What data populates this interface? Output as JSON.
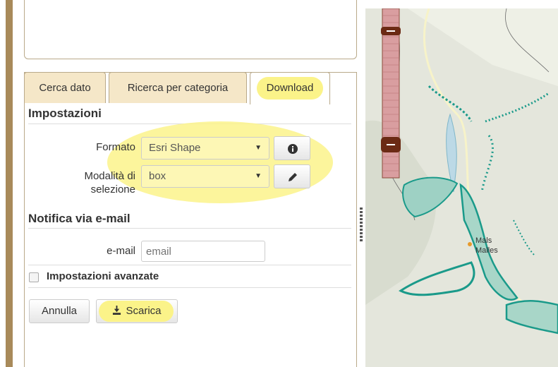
{
  "tabs": [
    {
      "label": "Cerca dato",
      "active": false
    },
    {
      "label": "Ricerca per categoria",
      "active": false
    },
    {
      "label": "Download",
      "active": true
    }
  ],
  "settings": {
    "title": "Impostazioni",
    "format_label": "Formato",
    "format_value": "Esri Shape",
    "selection_label_1": "Modalità di",
    "selection_label_2": "selezione",
    "selection_value": "box",
    "format_info_icon": "info-icon",
    "selection_edit_icon": "pencil-icon"
  },
  "email_section": {
    "title": "Notifica via e-mail",
    "email_label": "e-mail",
    "email_placeholder": "email",
    "email_value": ""
  },
  "advanced": {
    "label": "Impostazioni avanzate",
    "checked": false
  },
  "actions": {
    "cancel_label": "Annulla",
    "download_label": "Scarica",
    "download_icon": "download-icon"
  },
  "map": {
    "labels": [
      "Mals",
      "Malles"
    ]
  },
  "colors": {
    "accent_highlight": "#fbf389",
    "tab_inactive_bg": "#f5e7c8",
    "map_feature": "#1a9a8a",
    "zoom_thumb": "#6b2a14"
  }
}
